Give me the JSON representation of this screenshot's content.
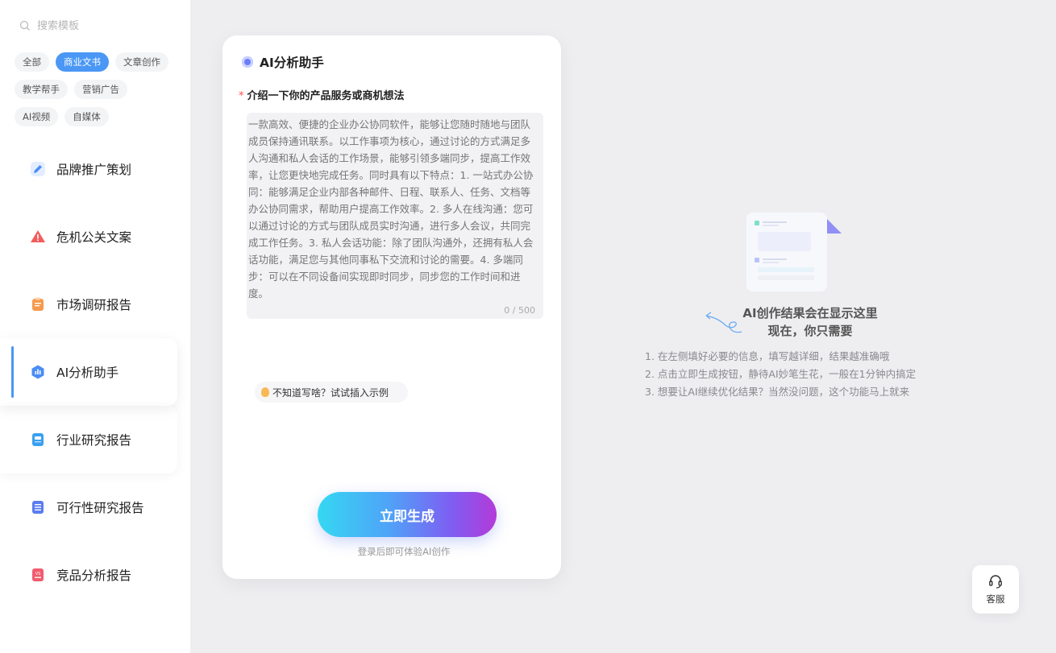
{
  "search": {
    "placeholder": "搜索模板"
  },
  "tags": [
    {
      "label": "全部",
      "active": false
    },
    {
      "label": "商业文书",
      "active": true
    },
    {
      "label": "文章创作",
      "active": false
    },
    {
      "label": "教学帮手",
      "active": false
    },
    {
      "label": "营销广告",
      "active": false
    },
    {
      "label": "AI视频",
      "active": false
    },
    {
      "label": "自媒体",
      "active": false
    }
  ],
  "menu": [
    {
      "label": "品牌推广策划",
      "icon": "pencil-icon",
      "color": "#4a8df6"
    },
    {
      "label": "危机公关文案",
      "icon": "warning-icon",
      "color": "#f25c5c"
    },
    {
      "label": "市场调研报告",
      "icon": "clipboard-icon",
      "color": "#f59a4e"
    },
    {
      "label": "AI分析助手",
      "icon": "hexagon-chart-icon",
      "color": "#4a8df6"
    },
    {
      "label": "行业研究报告",
      "icon": "report-icon",
      "color": "#3aa0f0"
    },
    {
      "label": "可行性研究报告",
      "icon": "list-icon",
      "color": "#5b7cf0"
    },
    {
      "label": "竞品分析报告",
      "icon": "vs-icon",
      "color": "#f25c6e"
    }
  ],
  "form": {
    "title": "AI分析助手",
    "required_mark": "*",
    "field_label": "介绍一下你的产品服务或商机想法",
    "placeholder": "一款高效、便捷的企业办公协同软件，能够让您随时随地与团队成员保持通讯联系。以工作事项为核心，通过讨论的方式满足多人沟通和私人会话的工作场景，能够引领多端同步，提高工作效率，让您更快地完成任务。同时具有以下特点：1. 一站式办公协同：能够满足企业内部各种邮件、日程、联系人、任务、文档等办公协同需求，帮助用户提高工作效率。2. 多人在线沟通：您可以通过讨论的方式与团队成员实时沟通，进行多人会议，共同完成工作任务。3. 私人会话功能：除了团队沟通外，还拥有私人会话功能，满足您与其他同事私下交流和讨论的需要。4. 多端同步：可以在不同设备间实现即时同步，同步您的工作时间和进度。",
    "counter": "0 / 500",
    "example_label": "不知道写啥？试试插入示例",
    "generate_label": "立即生成",
    "generate_hint": "登录后即可体验AI创作"
  },
  "empty": {
    "title_line1": "AI创作结果会在显示这里",
    "title_line2": "现在，你只需要",
    "tips": [
      "1. 在左侧填好必要的信息，填写越详细，结果越准确哦",
      "2. 点击立即生成按钮，静待AI妙笔生花，一般在1分钟内搞定",
      "3. 想要让AI继续优化结果？当然没问题，这个功能马上就来"
    ]
  },
  "support": {
    "label": "客服"
  }
}
